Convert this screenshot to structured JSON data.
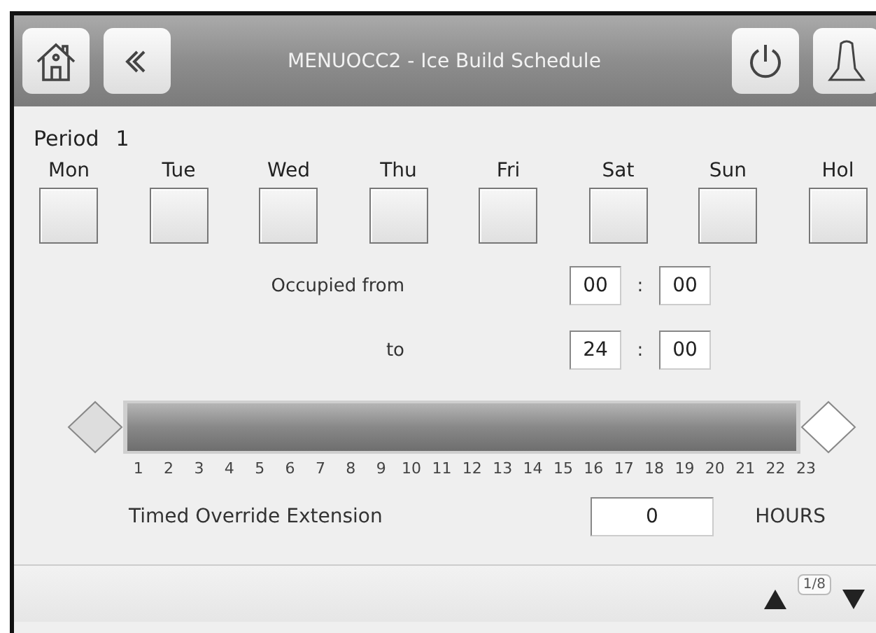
{
  "header": {
    "title": "MENUOCC2 - Ice Build Schedule"
  },
  "period": {
    "label": "Period",
    "value": "1"
  },
  "days": [
    {
      "label": "Mon",
      "checked": false
    },
    {
      "label": "Tue",
      "checked": false
    },
    {
      "label": "Wed",
      "checked": false
    },
    {
      "label": "Thu",
      "checked": false
    },
    {
      "label": "Fri",
      "checked": false
    },
    {
      "label": "Sat",
      "checked": false
    },
    {
      "label": "Sun",
      "checked": false
    },
    {
      "label": "Hol",
      "checked": false
    }
  ],
  "times": [
    {
      "label": "Occupied from",
      "hours": "00",
      "separator": ":",
      "minutes": "00"
    },
    {
      "label": "to",
      "hours": "24",
      "separator": ":",
      "minutes": "00"
    }
  ],
  "slider": {
    "level": 1,
    "ticks": [
      "1",
      "2",
      "3",
      "4",
      "5",
      "6",
      "7",
      "8",
      "9",
      "10",
      "11",
      "12",
      "13",
      "14",
      "15",
      "16",
      "17",
      "18",
      "19",
      "20",
      "21",
      "22",
      "23"
    ]
  },
  "override": {
    "label": "Timed Override Extension",
    "value": "0",
    "unit": "HOURS"
  },
  "pager": {
    "page": "1/8"
  }
}
